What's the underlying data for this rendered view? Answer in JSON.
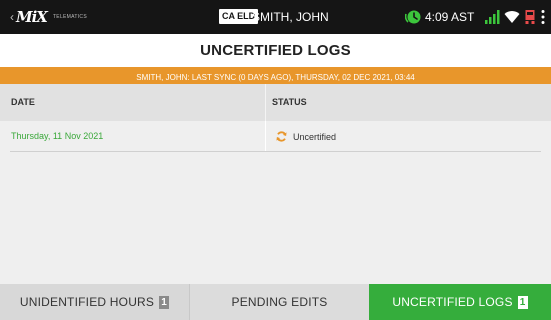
{
  "status_bar": {
    "logo_back": "‹",
    "logo_text": "MiX",
    "logo_subtext": "TELEMATICS",
    "eld_badge": "CA ELD",
    "driver_name": "SMITH, JOHN",
    "time": "4:09 AST",
    "icons": [
      "clock-icon",
      "signal-icon",
      "wifi-icon",
      "truck-icon",
      "more-menu-icon"
    ],
    "colors": {
      "clock": "#3cc63c",
      "signal": "#3cc63c",
      "wifi": "#ffffff",
      "truck": "#e84a4a"
    }
  },
  "page": {
    "title": "UNCERTIFIED LOGS"
  },
  "sync_banner": {
    "text": "SMITH, JOHN: LAST SYNC (0 DAYS AGO), THURSDAY, 02 DEC 2021, 03:44",
    "color": "#e8962b"
  },
  "table": {
    "headers": {
      "date": "DATE",
      "status": "STATUS"
    },
    "rows": [
      {
        "date": "Thursday, 11 Nov 2021",
        "status": "Uncertified",
        "status_icon": "sync-icon"
      }
    ]
  },
  "tabs": [
    {
      "label": "UNIDENTIFIED HOURS",
      "count": "1",
      "active": false
    },
    {
      "label": "PENDING EDITS",
      "count": "",
      "active": false
    },
    {
      "label": "UNCERTIFIED LOGS",
      "count": "1",
      "active": true
    }
  ],
  "accent_colors": {
    "active_tab": "#35ad3c",
    "date_text": "#3aa83a",
    "sync_icon": "#e8962b"
  }
}
